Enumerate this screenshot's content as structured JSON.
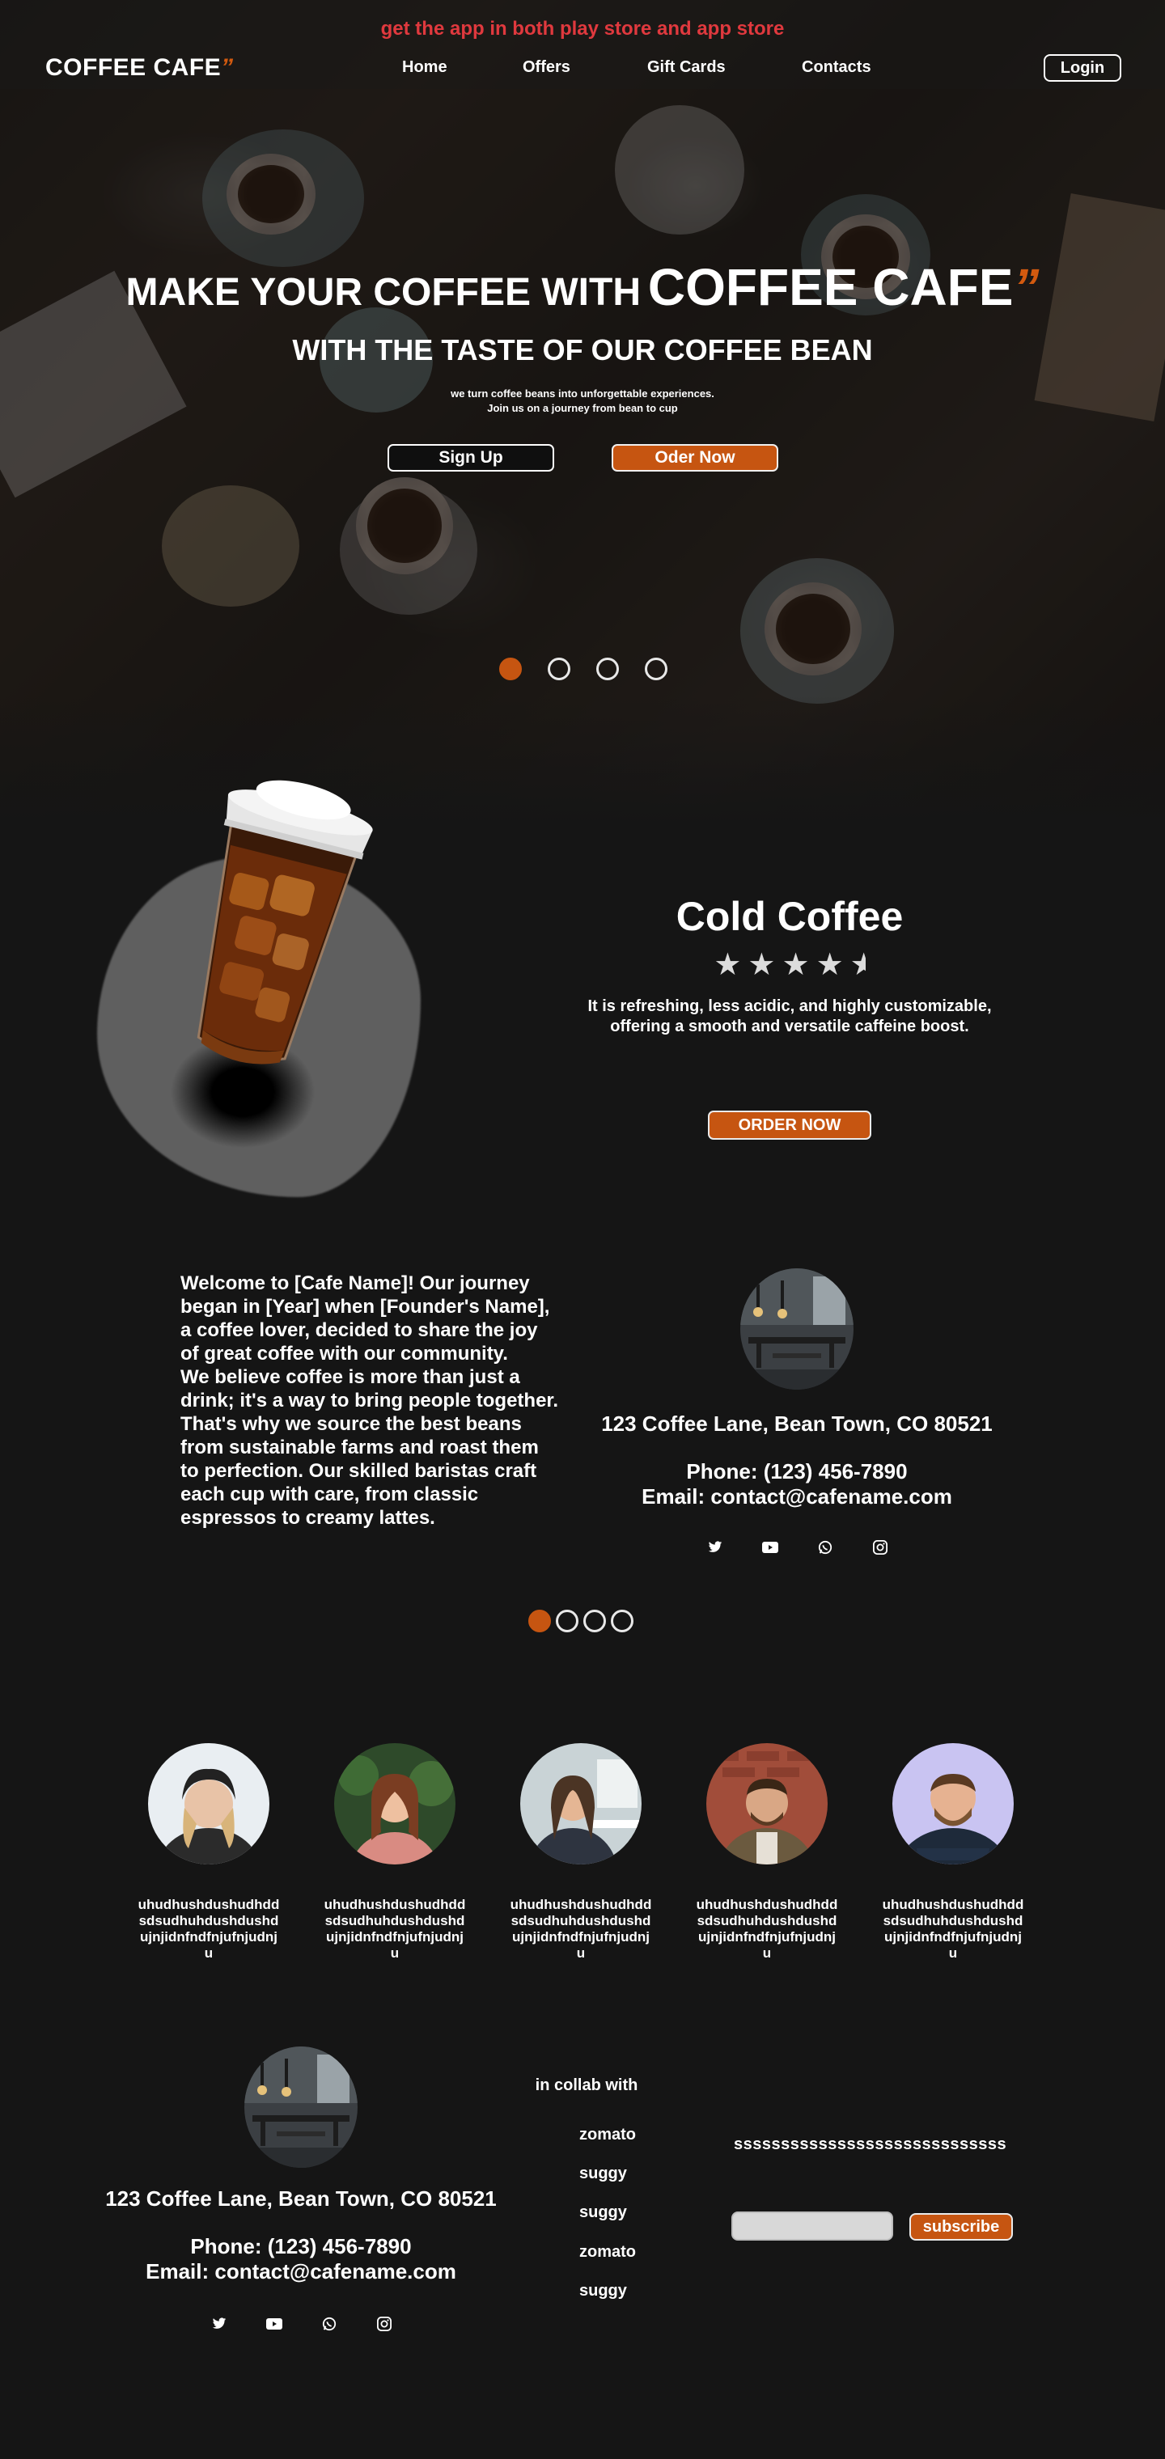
{
  "promo": {
    "text": "get the app in both play store and app store"
  },
  "brand": {
    "name": "COFFEE CAFE",
    "quote_mark": "”"
  },
  "nav": {
    "links": [
      "Home",
      "Offers",
      "Gift Cards",
      "Contacts"
    ],
    "login": "Login"
  },
  "hero": {
    "title_prefix": "MAKE YOUR COFFEE WITH",
    "title_brand": "COFFEE CAFE",
    "title_quote": "”",
    "subtitle": "WITH THE TASTE OF OUR COFFEE BEAN",
    "desc_line1": "we turn coffee beans into unforgettable experiences.",
    "desc_line2": "Join us on a journey from bean to cup",
    "signup": "Sign Up",
    "order": "Oder Now",
    "slides": 4,
    "active_slide": 1
  },
  "product": {
    "title": "Cold Coffee",
    "rating": 4.5,
    "rating_max": 5,
    "desc_line1": "It is refreshing, less acidic, and highly customizable,",
    "desc_line2": "offering a smooth and versatile caffeine boost.",
    "order": "ORDER NOW"
  },
  "about": {
    "text": "Welcome to [Cafe Name]! Our journey began in [Year] when [Founder's Name], a coffee lover, decided to share the joy of great coffee with our community.\nWe believe coffee is more than just a drink; it's a way to bring people together. That's why we source the best beans from sustainable farms and roast them to perfection. Our skilled baristas craft each cup with care, from classic espressos to creamy lattes.",
    "address": "123 Coffee Lane, Bean Town, CO 80521",
    "phone": "Phone: (123) 456-7890",
    "email": "Email: contact@cafename.com",
    "social": [
      "twitter-icon",
      "youtube-icon",
      "whatsapp-icon",
      "instagram-icon"
    ],
    "slides": 4,
    "active_slide": 1
  },
  "team": {
    "members": [
      {
        "bio": "uhudhushdushudhddsdsudhuhdushdushdujnjidnfndfnjufnjudnju"
      },
      {
        "bio": "uhudhushdushudhddsdsudhuhdushdushdujnjidnfndfnjufnjudnju"
      },
      {
        "bio": "uhudhushdushudhddsdsudhuhdushdushdujnjidnfndfnjufnjudnju"
      },
      {
        "bio": "uhudhushdushudhddsdsudhuhdushdushdujnjidnfndfnjufnjudnju"
      },
      {
        "bio": "uhudhushdushudhddsdsudhuhdushdushdujnjidnfndfnjufnjudnju"
      }
    ]
  },
  "footer": {
    "address": "123 Coffee Lane, Bean Town, CO 80521",
    "phone": "Phone: (123) 456-7890",
    "email": "Email: contact@cafename.com",
    "collab_title": "in collab with",
    "collab": [
      "zomato",
      "suggy",
      "suggy",
      "zomato",
      "suggy"
    ],
    "newsletter_text": "sssssssssssssssssssssssssssss",
    "input_placeholder": "",
    "subscribe": "subscribe"
  },
  "colors": {
    "accent": "#c65511",
    "promo": "#e0393e",
    "background": "#151515"
  }
}
